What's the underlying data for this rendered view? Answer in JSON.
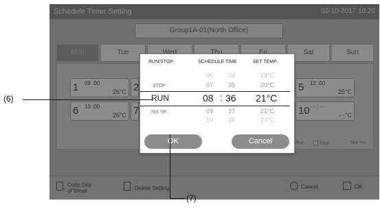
{
  "screen": {
    "title": "Schedule Timer Setting",
    "datetime": "02-10-2017  10:20",
    "group": "Group1A-01(North Office)"
  },
  "tabs": [
    {
      "label": "Mon",
      "active": true
    },
    {
      "label": "Tue",
      "active": false
    },
    {
      "label": "Wed",
      "active": false
    },
    {
      "label": "Thu",
      "active": false
    },
    {
      "label": "Fri",
      "active": false
    },
    {
      "label": "Sat",
      "active": false
    },
    {
      "label": "Sun",
      "active": false
    }
  ],
  "slots": [
    {
      "num": "1",
      "time": "09 :00",
      "temp": "26°C"
    },
    {
      "num": "2"
    },
    {
      "num": "5",
      "time": "12 :00",
      "temp": "25°C"
    },
    {
      "num": "6",
      "time": "13 :00",
      "temp": "26°C"
    },
    {
      "num": "7"
    },
    {
      "num": "10",
      "time": "- - : - -",
      "temp": "- -°C"
    }
  ],
  "slot_fragment": "C",
  "legend": [
    "Run",
    "Stop",
    "Not Yet"
  ],
  "bottom": {
    "copy": [
      "Copy Day",
      "of Week"
    ],
    "delete": "Delete Setting",
    "cancel": "Cancel",
    "ok": "OK"
  },
  "picker": {
    "headers": {
      "run_stop": "RUN/STOP",
      "schedule_time": "SCHEDULE TIME",
      "set_temp": "SET TEMP."
    },
    "above2": {
      "hour": "06",
      "minute": "34",
      "temp": "19°C"
    },
    "above1": {
      "label": "STOP",
      "hour": "07",
      "minute": "35",
      "temp": "20°C"
    },
    "selected": {
      "label": "RUN",
      "hour": "08",
      "sep": ":",
      "minute": "36",
      "temp": "21°C"
    },
    "below1": {
      "label": "Not Yet",
      "hour": "09",
      "minute": "37",
      "temp": "22°C"
    },
    "below2": {
      "hour": "10",
      "minute": "38",
      "temp": "23°C"
    },
    "ok": "OK",
    "cancel": "Cancel"
  },
  "callouts": {
    "c6": "(6)",
    "c7": "(7)"
  }
}
